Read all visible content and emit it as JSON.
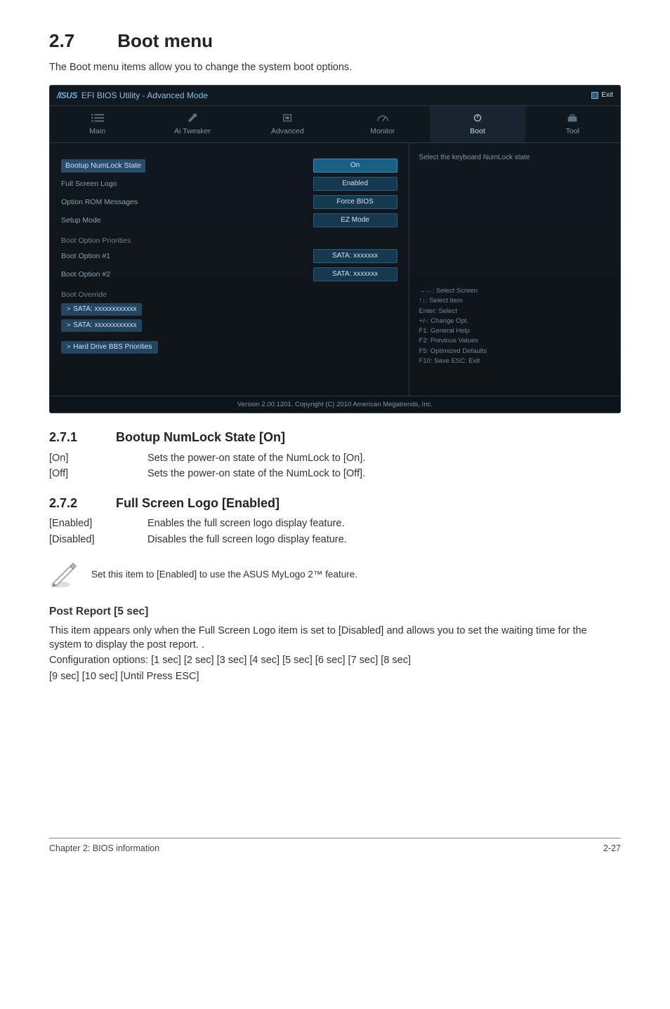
{
  "section": {
    "number": "2.7",
    "title": "Boot menu"
  },
  "intro": "The Boot menu items allow you to change the system boot options.",
  "bios": {
    "title": "EFI BIOS Utility - Advanced Mode",
    "logo": "/ISUS",
    "exit": "Exit",
    "tabs": [
      {
        "label": "Main"
      },
      {
        "label": "Ai  Tweaker"
      },
      {
        "label": "Advanced"
      },
      {
        "label": "Monitor"
      },
      {
        "label": "Boot",
        "selected": true
      },
      {
        "label": "Tool"
      }
    ],
    "rows": [
      {
        "label": "Bootup NumLock State",
        "value": "On",
        "highlight": true,
        "selected": true
      },
      {
        "label": "Full Screen Logo",
        "value": "Enabled"
      },
      {
        "label": "Option ROM Messages",
        "value": "Force BIOS"
      },
      {
        "label": "Setup Mode",
        "value": "EZ Mode"
      }
    ],
    "boot_priorities_header": "Boot Option Priorities",
    "boot_options": [
      {
        "label": "Boot Option #1",
        "value": "SATA: xxxxxxx"
      },
      {
        "label": "Boot Option #2",
        "value": "SATA: xxxxxxx"
      }
    ],
    "boot_override_header": "Boot Override",
    "overrides": [
      "SATA: xxxxxxxxxxxx",
      "SATA: xxxxxxxxxxxx",
      "Hard Drive BBS Priorities"
    ],
    "right_help_top": "Select the keyboard NumLock state",
    "help_lines": [
      "→←: Select Screen",
      "↑↓: Select Item",
      "Enter: Select",
      "+/-: Change Opt.",
      "F1: General Help",
      "F2: Previous Values",
      "F5: Optimized Defaults",
      "F10: Save   ESC: Exit"
    ],
    "footer": "Version 2.00.1201.   Copyright  (C)  2010 American  Megatrends,  Inc."
  },
  "sub1": {
    "number": "2.7.1",
    "title": "Bootup NumLock State [On]",
    "opts": [
      {
        "key": "[On]",
        "val": "Sets the power-on state of the NumLock to [On]."
      },
      {
        "key": "[Off]",
        "val": "Sets the power-on state of the NumLock to [Off]."
      }
    ]
  },
  "sub2": {
    "number": "2.7.2",
    "title": "Full Screen Logo [Enabled]",
    "opts": [
      {
        "key": "[Enabled]",
        "val": "Enables the full screen logo display feature."
      },
      {
        "key": "[Disabled]",
        "val": "Disables the full screen logo display feature."
      }
    ]
  },
  "note": "Set this item to [Enabled] to use the ASUS MyLogo 2™ feature.",
  "post_report": {
    "title": "Post Report [5 sec]",
    "p1": "This item appears only when the Full Screen Logo item is set to [Disabled] and allows you to set the waiting time for the system to display the post report. .",
    "p2": "Configuration options: [1 sec] [2 sec] [3 sec] [4 sec] [5 sec] [6 sec] [7 sec] [8 sec]",
    "p3": "[9 sec] [10 sec] [Until Press ESC]"
  },
  "footer": {
    "left": "Chapter 2: BIOS information",
    "right": "2-27"
  }
}
